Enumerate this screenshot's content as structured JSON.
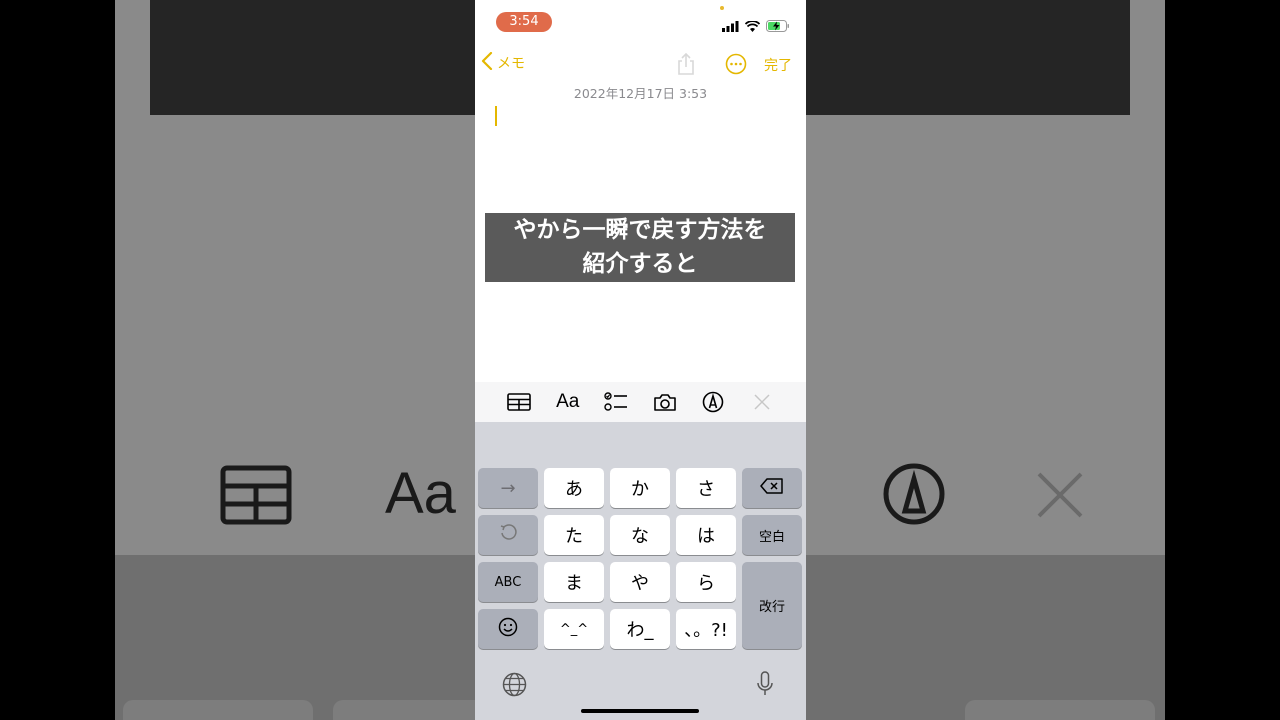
{
  "status_bar": {
    "time": "3:54"
  },
  "nav": {
    "back_label": "メモ",
    "done_label": "完了"
  },
  "note": {
    "date": "2022年12月17日 3:53"
  },
  "caption": {
    "line1": "やから一瞬で戻す方法を",
    "line2": "紹介すると"
  },
  "toolbar": {
    "format_label": "Aa"
  },
  "keyboard": {
    "keys": {
      "arrow": "→",
      "a": "あ",
      "ka": "か",
      "sa": "さ",
      "ta": "た",
      "na": "な",
      "ha": "は",
      "space": "空白",
      "abc": "ABC",
      "ma": "ま",
      "ya": "や",
      "ra": "ら",
      "return": "改行",
      "kaomoji": "^_^",
      "wa": "わ_",
      "punct": "、。?!"
    }
  },
  "background": {
    "format_label": "Aa"
  },
  "colors": {
    "accent": "#e4b700",
    "time_pill": "#e06b4a",
    "caption_bg": "#5a5a5a"
  }
}
